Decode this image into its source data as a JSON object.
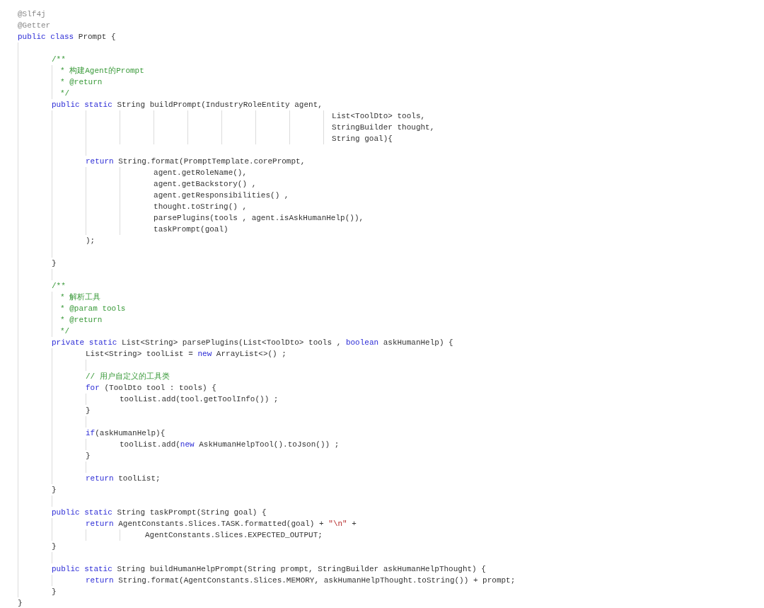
{
  "code_lines": [
    {
      "kind": "code",
      "tokens": [
        {
          "kind": "annotation",
          "text": "@Slf4j"
        }
      ]
    },
    {
      "kind": "code",
      "tokens": [
        {
          "kind": "annotation",
          "text": "@Getter"
        }
      ]
    },
    {
      "kind": "code",
      "tokens": [
        {
          "kind": "keyword",
          "text": "public class"
        },
        {
          "kind": "plain",
          "text": " Prompt {"
        }
      ]
    },
    {
      "kind": "blank"
    },
    {
      "kind": "code",
      "tokens": [
        {
          "kind": "comment",
          "text": "    /**"
        }
      ]
    },
    {
      "kind": "code",
      "tokens": [
        {
          "kind": "comment",
          "text": "     * 构建Agent的Prompt"
        }
      ]
    },
    {
      "kind": "code",
      "tokens": [
        {
          "kind": "comment",
          "text": "     * @return"
        }
      ]
    },
    {
      "kind": "code",
      "tokens": [
        {
          "kind": "comment",
          "text": "     */"
        }
      ]
    },
    {
      "kind": "code",
      "tokens": [
        {
          "kind": "keyword",
          "text": "    public static"
        },
        {
          "kind": "plain",
          "text": " String buildPrompt(IndustryRoleEntity agent,"
        }
      ]
    },
    {
      "kind": "code",
      "tokens": [
        {
          "kind": "plain",
          "text": "                                     List<ToolDto> tools,"
        }
      ]
    },
    {
      "kind": "code",
      "tokens": [
        {
          "kind": "plain",
          "text": "                                     StringBuilder thought,"
        }
      ]
    },
    {
      "kind": "code",
      "tokens": [
        {
          "kind": "plain",
          "text": "                                     String goal){"
        }
      ]
    },
    {
      "kind": "blank"
    },
    {
      "kind": "code",
      "tokens": [
        {
          "kind": "keyword",
          "text": "        return"
        },
        {
          "kind": "plain",
          "text": " String.format(PromptTemplate.corePrompt,"
        }
      ]
    },
    {
      "kind": "code",
      "tokens": [
        {
          "kind": "plain",
          "text": "                agent.getRoleName(),"
        }
      ]
    },
    {
      "kind": "code",
      "tokens": [
        {
          "kind": "plain",
          "text": "                agent.getBackstory() ,"
        }
      ]
    },
    {
      "kind": "code",
      "tokens": [
        {
          "kind": "plain",
          "text": "                agent.getResponsibilities() ,"
        }
      ]
    },
    {
      "kind": "code",
      "tokens": [
        {
          "kind": "plain",
          "text": "                thought.toString() ,"
        }
      ]
    },
    {
      "kind": "code",
      "tokens": [
        {
          "kind": "plain",
          "text": "                parsePlugins(tools , agent.isAskHumanHelp()),"
        }
      ]
    },
    {
      "kind": "code",
      "tokens": [
        {
          "kind": "plain",
          "text": "                taskPrompt(goal)"
        }
      ]
    },
    {
      "kind": "code",
      "tokens": [
        {
          "kind": "plain",
          "text": "        );"
        }
      ]
    },
    {
      "kind": "blank"
    },
    {
      "kind": "code",
      "tokens": [
        {
          "kind": "plain",
          "text": "    }"
        }
      ]
    },
    {
      "kind": "blank"
    },
    {
      "kind": "code",
      "tokens": [
        {
          "kind": "comment",
          "text": "    /**"
        }
      ]
    },
    {
      "kind": "code",
      "tokens": [
        {
          "kind": "comment",
          "text": "     * 解析工具"
        }
      ]
    },
    {
      "kind": "code",
      "tokens": [
        {
          "kind": "comment",
          "text": "     * @param tools"
        }
      ]
    },
    {
      "kind": "code",
      "tokens": [
        {
          "kind": "comment",
          "text": "     * @return"
        }
      ]
    },
    {
      "kind": "code",
      "tokens": [
        {
          "kind": "comment",
          "text": "     */"
        }
      ]
    },
    {
      "kind": "code",
      "tokens": [
        {
          "kind": "keyword",
          "text": "    private static"
        },
        {
          "kind": "plain",
          "text": " List<String> parsePlugins(List<ToolDto> tools , "
        },
        {
          "kind": "keyword",
          "text": "boolean"
        },
        {
          "kind": "plain",
          "text": " askHumanHelp) {"
        }
      ]
    },
    {
      "kind": "code",
      "tokens": [
        {
          "kind": "plain",
          "text": "        List<String> toolList = "
        },
        {
          "kind": "keyword",
          "text": "new"
        },
        {
          "kind": "plain",
          "text": " ArrayList<>() ;"
        }
      ]
    },
    {
      "kind": "blank"
    },
    {
      "kind": "code",
      "tokens": [
        {
          "kind": "comment",
          "text": "        // 用户自定义的工具类"
        }
      ]
    },
    {
      "kind": "code",
      "tokens": [
        {
          "kind": "keyword",
          "text": "        for"
        },
        {
          "kind": "plain",
          "text": " (ToolDto tool : tools) {"
        }
      ]
    },
    {
      "kind": "code",
      "tokens": [
        {
          "kind": "plain",
          "text": "            toolList.add(tool.getToolInfo()) ;"
        }
      ]
    },
    {
      "kind": "code",
      "tokens": [
        {
          "kind": "plain",
          "text": "        }"
        }
      ]
    },
    {
      "kind": "blank"
    },
    {
      "kind": "code",
      "tokens": [
        {
          "kind": "keyword",
          "text": "        if"
        },
        {
          "kind": "plain",
          "text": "(askHumanHelp){"
        }
      ]
    },
    {
      "kind": "code",
      "tokens": [
        {
          "kind": "plain",
          "text": "            toolList.add("
        },
        {
          "kind": "keyword",
          "text": "new"
        },
        {
          "kind": "plain",
          "text": " AskHumanHelpTool().toJson()) ;"
        }
      ]
    },
    {
      "kind": "code",
      "tokens": [
        {
          "kind": "plain",
          "text": "        }"
        }
      ]
    },
    {
      "kind": "blank"
    },
    {
      "kind": "code",
      "tokens": [
        {
          "kind": "keyword",
          "text": "        return"
        },
        {
          "kind": "plain",
          "text": " toolList;"
        }
      ]
    },
    {
      "kind": "code",
      "tokens": [
        {
          "kind": "plain",
          "text": "    }"
        }
      ]
    },
    {
      "kind": "blank"
    },
    {
      "kind": "code",
      "tokens": [
        {
          "kind": "keyword",
          "text": "    public static"
        },
        {
          "kind": "plain",
          "text": " String taskPrompt(String goal) {"
        }
      ]
    },
    {
      "kind": "code",
      "tokens": [
        {
          "kind": "keyword",
          "text": "        return"
        },
        {
          "kind": "plain",
          "text": " AgentConstants.Slices.TASK.formatted(goal) + "
        },
        {
          "kind": "string",
          "text": "\"\\n\""
        },
        {
          "kind": "plain",
          "text": " +"
        }
      ]
    },
    {
      "kind": "code",
      "tokens": [
        {
          "kind": "plain",
          "text": "               AgentConstants.Slices.EXPECTED_OUTPUT;"
        }
      ]
    },
    {
      "kind": "code",
      "tokens": [
        {
          "kind": "plain",
          "text": "    }"
        }
      ]
    },
    {
      "kind": "blank"
    },
    {
      "kind": "code",
      "tokens": [
        {
          "kind": "keyword",
          "text": "    public static"
        },
        {
          "kind": "plain",
          "text": " String buildHumanHelpPrompt(String prompt, StringBuilder askHumanHelpThought) {"
        }
      ]
    },
    {
      "kind": "code",
      "tokens": [
        {
          "kind": "keyword",
          "text": "        return"
        },
        {
          "kind": "plain",
          "text": " String.format(AgentConstants.Slices.MEMORY, askHumanHelpThought.toString()) + prompt;"
        }
      ]
    },
    {
      "kind": "code",
      "tokens": [
        {
          "kind": "plain",
          "text": "    }"
        }
      ]
    },
    {
      "kind": "code",
      "tokens": [
        {
          "kind": "plain",
          "text": "}"
        }
      ]
    }
  ]
}
